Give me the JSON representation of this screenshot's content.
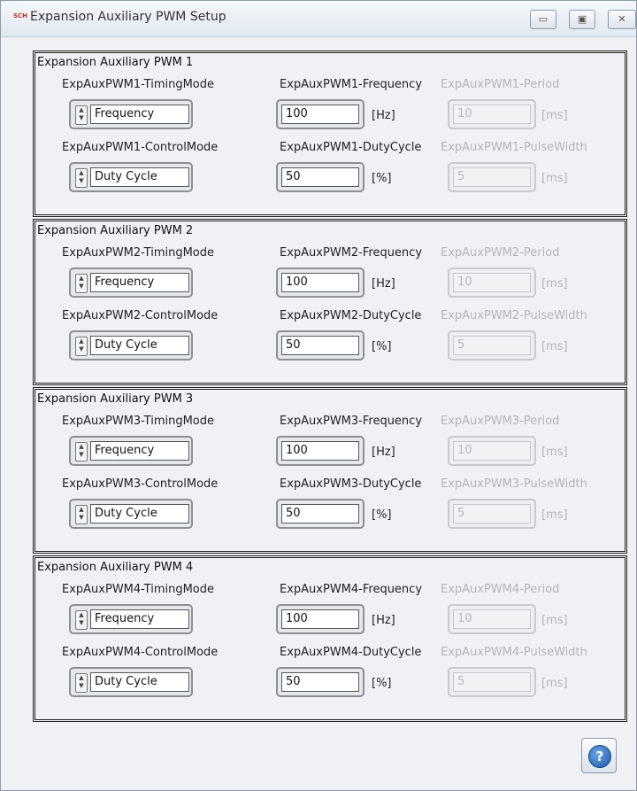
{
  "window": {
    "title": "Expansion Auxiliary PWM Setup",
    "app_icon": "SCH",
    "controls": {
      "minimize": "▭",
      "maximize": "▣",
      "close": "✕"
    }
  },
  "groups": [
    {
      "title": "Expansion Auxiliary PWM 1",
      "timing_mode_label": "ExpAuxPWM1-TimingMode",
      "timing_mode_value": "Frequency",
      "frequency_label": "ExpAuxPWM1-Frequency",
      "frequency_value": "100",
      "frequency_unit": "[Hz]",
      "period_label": "ExpAuxPWM1-Period",
      "period_value": "10",
      "period_unit": "[ms]",
      "control_mode_label": "ExpAuxPWM1-ControlMode",
      "control_mode_value": "Duty Cycle",
      "duty_label": "ExpAuxPWM1-DutyCycle",
      "duty_value": "50",
      "duty_unit": "[%]",
      "pulse_label": "ExpAuxPWM1-PulseWidth",
      "pulse_value": "5",
      "pulse_unit": "[ms]"
    },
    {
      "title": "Expansion Auxiliary PWM 2",
      "timing_mode_label": "ExpAuxPWM2-TimingMode",
      "timing_mode_value": "Frequency",
      "frequency_label": "ExpAuxPWM2-Frequency",
      "frequency_value": "100",
      "frequency_unit": "[Hz]",
      "period_label": "ExpAuxPWM2-Period",
      "period_value": "10",
      "period_unit": "[ms]",
      "control_mode_label": "ExpAuxPWM2-ControlMode",
      "control_mode_value": "Duty Cycle",
      "duty_label": "ExpAuxPWM2-DutyCycle",
      "duty_value": "50",
      "duty_unit": "[%]",
      "pulse_label": "ExpAuxPWM2-PulseWidth",
      "pulse_value": "5",
      "pulse_unit": "[ms]"
    },
    {
      "title": "Expansion Auxiliary PWM 3",
      "timing_mode_label": "ExpAuxPWM3-TimingMode",
      "timing_mode_value": "Frequency",
      "frequency_label": "ExpAuxPWM3-Frequency",
      "frequency_value": "100",
      "frequency_unit": "[Hz]",
      "period_label": "ExpAuxPWM3-Period",
      "period_value": "10",
      "period_unit": "[ms]",
      "control_mode_label": "ExpAuxPWM3-ControlMode",
      "control_mode_value": "Duty Cycle",
      "duty_label": "ExpAuxPWM3-DutyCycle",
      "duty_value": "50",
      "duty_unit": "[%]",
      "pulse_label": "ExpAuxPWM3-PulseWidth",
      "pulse_value": "5",
      "pulse_unit": "[ms]"
    },
    {
      "title": "Expansion Auxiliary PWM 4",
      "timing_mode_label": "ExpAuxPWM4-TimingMode",
      "timing_mode_value": "Frequency",
      "frequency_label": "ExpAuxPWM4-Frequency",
      "frequency_value": "100",
      "frequency_unit": "[Hz]",
      "period_label": "ExpAuxPWM4-Period",
      "period_value": "10",
      "period_unit": "[ms]",
      "control_mode_label": "ExpAuxPWM4-ControlMode",
      "control_mode_value": "Duty Cycle",
      "duty_label": "ExpAuxPWM4-DutyCycle",
      "duty_value": "50",
      "duty_unit": "[%]",
      "pulse_label": "ExpAuxPWM4-PulseWidth",
      "pulse_value": "5",
      "pulse_unit": "[ms]"
    }
  ],
  "help": {
    "glyph": "?"
  }
}
